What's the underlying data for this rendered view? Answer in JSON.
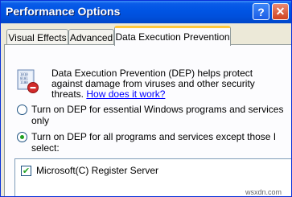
{
  "window": {
    "title": "Performance Options",
    "help_symbol": "?",
    "close_symbol": "✕"
  },
  "tabs": [
    {
      "label": "Visual Effects"
    },
    {
      "label": "Advanced"
    },
    {
      "label": "Data Execution Prevention",
      "active": true
    }
  ],
  "dep": {
    "description": "Data Execution Prevention (DEP) helps protect against damage from viruses and other security threats.",
    "link": "How does it work?",
    "icon": "dep-shield-icon"
  },
  "options": [
    {
      "label": "Turn on DEP for essential Windows programs and services only",
      "selected": false
    },
    {
      "label": "Turn on DEP for all programs and services except those I select:",
      "selected": true
    }
  ],
  "programs": [
    {
      "label": "Microsoft(C) Register Server",
      "checked": true,
      "check_symbol": "✔"
    }
  ],
  "watermark": "wsxdn.com",
  "colors": {
    "titlebar": "#0054e3",
    "dialog_bg": "#ece9d8",
    "active_tab_highlight": "#ffc83c",
    "radio_dot": "#21a121",
    "link": "#0000ff"
  }
}
